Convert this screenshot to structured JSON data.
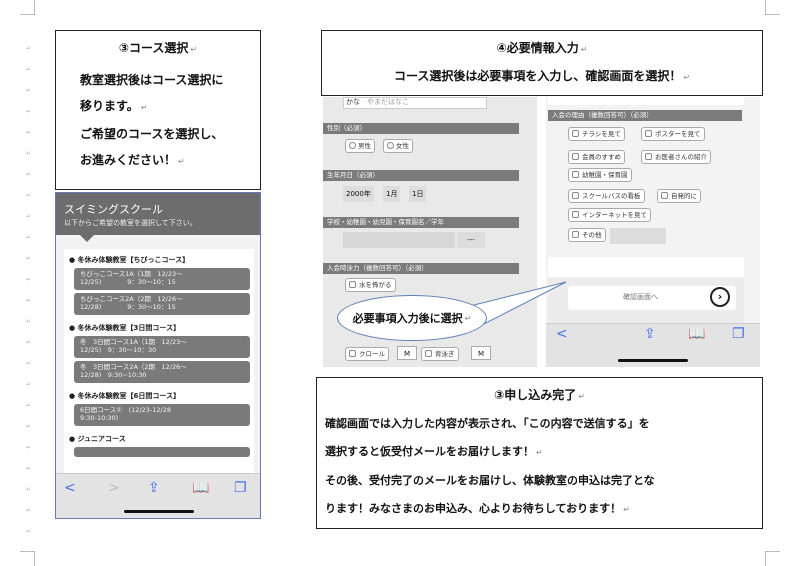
{
  "step_course": {
    "heading": "③コース選択",
    "lines": [
      "教室選択後はコース選択に",
      "移ります。",
      "ご希望のコースを選択し、",
      "お進みください！"
    ]
  },
  "phone_course": {
    "title": "スイミングスクール",
    "subtitle": "以下からご希望の教室を選択して下さい。",
    "groups": [
      {
        "name": "● 冬休み体験教室【ちびっこコース】",
        "courses": [
          [
            "ちびっこコース1A（1期　12/23～",
            "12/25)　　　　9：30～10：15"
          ],
          [
            "ちびっこコース2A（2期　12/26～",
            "12/28)　　　　9：30～10：15"
          ]
        ]
      },
      {
        "name": "● 冬休み体験教室【3日間コース】",
        "courses": [
          [
            "冬　3日間コース1A（1期　12/23～",
            "12/25)　9：30～10：30"
          ],
          [
            "冬　3日間コース2A（2期　12/26～",
            "12/28)　9:30~10:30"
          ]
        ]
      },
      {
        "name": "● 冬休み体験教室【6日間コース】",
        "courses": [
          [
            "6日間コース①　(12/23-12/28",
            "9:30-10:30)"
          ]
        ]
      },
      {
        "name": "● ジュニアコース",
        "courses": []
      }
    ],
    "toolbar": [
      "<",
      ">",
      "⇪",
      "📖",
      "❐"
    ]
  },
  "step_info": {
    "heading": "④必要情報入力",
    "line": "コース選択後は必要事項を入力し、確認画面を選択！"
  },
  "phone_form": {
    "kana_label": "かな",
    "kana_placeholder": "やまだはなこ",
    "gender_label": "性別（必須）",
    "gender_options": [
      "男性",
      "女性"
    ],
    "birth_label": "生年月日（必須）",
    "birth_year": "2000年",
    "birth_month": "1月",
    "birth_day": "1日",
    "school_label": "学校・幼稚園・幼児園・保育園名／学年",
    "school_grade": "---",
    "swim_label": "入会時泳力（複数回答可）（必須）",
    "swim_options": [
      "水を怖がる",
      "クロール",
      "M",
      "背泳ぎ",
      "M"
    ]
  },
  "phone_reason": {
    "label": "入会の理由（複数回答可）（必須）",
    "options": [
      "チラシを見て",
      "ポスターを見て",
      "会員のすすめ",
      "お医者さんの紹介",
      "幼稚園・保育園",
      "スクールバスの看板",
      "自発的に",
      "インターネットを見て",
      "その他"
    ],
    "confirm": "確認画面へ",
    "toolbar": [
      "<",
      "⇪",
      "📖",
      "❐"
    ]
  },
  "callout": "必要事項入力後に選択",
  "step_done": {
    "heading": "③申し込み完了",
    "lines": [
      "確認画面では入力した内容が表示され、「この内容で送信する」を",
      "選択すると仮受付メールをお届けします！",
      "その後、受付完了のメールをお届けし、体験教室の申込は完了とな",
      "ります！みなさまのお申込み、心よりお待ちしております！"
    ]
  },
  "return_mark": "↵"
}
